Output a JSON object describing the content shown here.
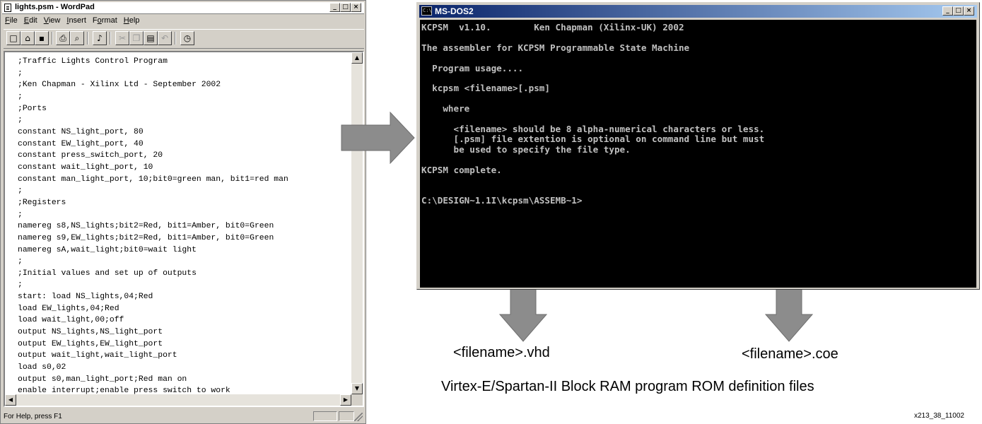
{
  "wordpad": {
    "title": "lights.psm - WordPad",
    "menu": [
      {
        "key": "F",
        "rest": "ile"
      },
      {
        "key": "E",
        "rest": "dit"
      },
      {
        "key": "V",
        "rest": "iew"
      },
      {
        "key": "I",
        "rest": "nsert"
      },
      {
        "key": "o",
        "pre": "F",
        "rest": "rmat"
      },
      {
        "key": "H",
        "rest": "elp"
      }
    ],
    "toolbar_icons": [
      "new-icon",
      "open-icon",
      "save-icon",
      "print-icon",
      "print-preview-icon",
      "find-icon",
      "cut-icon",
      "copy-icon",
      "paste-icon",
      "undo-icon",
      "insert-datetime-icon"
    ],
    "code_lines": [
      ";Traffic Lights Control Program",
      ";",
      ";Ken Chapman - Xilinx Ltd - September 2002",
      ";",
      ";Ports",
      ";",
      "constant NS_light_port, 80",
      "constant EW_light_port, 40",
      "constant press_switch_port, 20",
      "constant wait_light_port, 10",
      "constant man_light_port, 10;bit0=green man, bit1=red man",
      ";",
      ";Registers",
      ";",
      "namereg s8,NS_lights;bit2=Red, bit1=Amber, bit0=Green",
      "namereg s9,EW_lights;bit2=Red, bit1=Amber, bit0=Green",
      "namereg sA,wait_light;bit0=wait light",
      ";",
      ";Initial values and set up of outputs",
      ";",
      "start: load NS_lights,04;Red",
      "load EW_lights,04;Red",
      "load wait_light,00;off",
      "output NS_lights,NS_light_port",
      "output EW_lights,EW_light_port",
      "output wait_light,wait_light_port",
      "load s0,02",
      "output s0,man_light_port;Red man on",
      "enable interrupt;enable press switch to work"
    ],
    "status": "For Help, press F1"
  },
  "dos": {
    "title": "MS-DOS2",
    "icon_text": "C:\\",
    "lines": [
      "KCPSM  v1.10.        Ken Chapman (Xilinx-UK) 2002",
      "",
      "The assembler for KCPSM Programmable State Machine",
      "",
      "  Program usage....",
      "",
      "  kcpsm <filename>[.psm]",
      "",
      "    where",
      "",
      "      <filename> should be 8 alpha-numerical characters or less.",
      "      [.psm] file extention is optional on command line but must",
      "      be used to specify the file type.",
      "",
      "KCPSM complete.",
      "",
      "",
      "C:\\DESIGN~1.1I\\kcpsm\\ASSEMB~1>"
    ]
  },
  "captions": {
    "vhd": "<filename>.vhd",
    "coe": "<filename>.coe",
    "description": "Virtex-E/Spartan-II Block RAM program ROM definition files",
    "figure_id": "x213_38_11002"
  },
  "colors": {
    "arrow_fill": "#8c8c8c",
    "dos_title_start": "#0a246a",
    "dos_title_end": "#a6caf0",
    "dos_text": "#c0c0c0"
  }
}
